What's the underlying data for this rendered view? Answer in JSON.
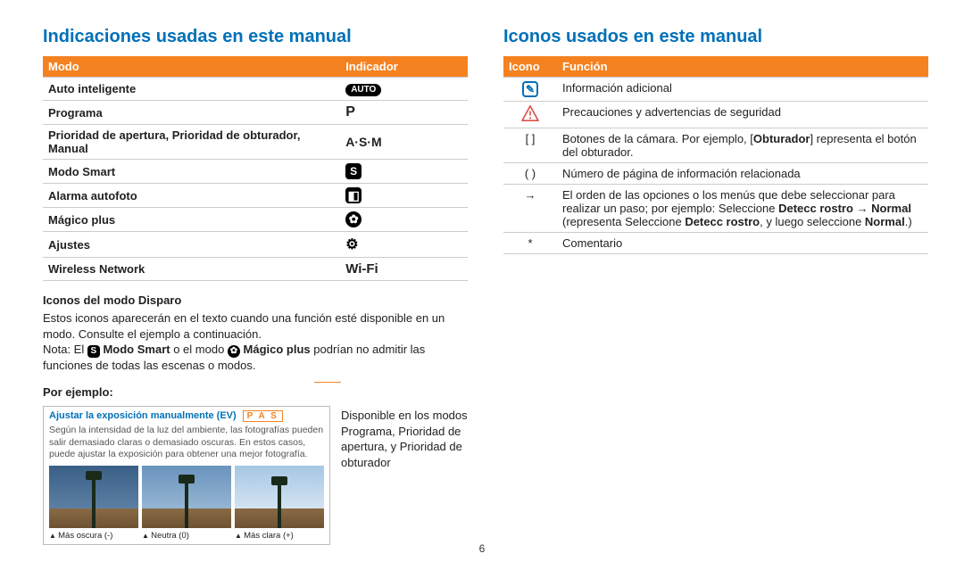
{
  "left": {
    "heading": "Indicaciones usadas en este manual",
    "table": {
      "head_mode": "Modo",
      "head_indicator": "Indicador",
      "rows": {
        "auto": "Auto inteligente",
        "auto_ind": "AUTO",
        "program": "Programa",
        "program_ind": "P",
        "asm": "Prioridad de apertura, Prioridad de obturador, Manual",
        "asm_ind": "A·S·M",
        "smart": "Modo Smart",
        "smart_ind": "S",
        "alarm": "Alarma autofoto",
        "magic": "Mágico plus",
        "settings": "Ajustes",
        "wireless": "Wireless Network",
        "wireless_ind": "Wi-Fi"
      }
    },
    "sub1_head": "Iconos del modo Disparo",
    "sub1_p1": "Estos iconos aparecerán en el texto cuando una función esté disponible en un modo. Consulte el ejemplo a continuación.",
    "sub1_p2a": "Nota: El ",
    "sub1_p2b": " Modo Smart",
    "sub1_p2c": " o el modo ",
    "sub1_p2d": " Mágico plus",
    "sub1_p2e": " podrían no admitir las funciones de todas las escenas o modos.",
    "example_head": "Por ejemplo:",
    "ex_title": "Ajustar la exposición manualmente (EV)",
    "ex_pas": "P A S",
    "ex_body": "Según la intensidad de la luz del ambiente, las fotografías pueden salir demasiado claras o demasiado oscuras. En estos casos, puede ajustar la exposición para obtener una mejor fotografía.",
    "cap_dark": "Más oscura (-)",
    "cap_neutral": "Neutra (0)",
    "cap_light": "Más clara (+)",
    "side_note": "Disponible en los modos Programa, Prioridad de apertura, y Prioridad de obturador"
  },
  "right": {
    "heading": "Iconos usados en este manual",
    "head_icon": "Icono",
    "head_func": "Función",
    "rows": {
      "info": "Información adicional",
      "warn": "Precauciones y advertencias de seguridad",
      "brackets_icon": "[  ]",
      "brackets_a": "Botones de la cámara. Por ejemplo, [",
      "brackets_bold": "Obturador",
      "brackets_b": "] representa el botón del obturador.",
      "paren_icon": "(  )",
      "paren": "Número de página de información relacionada",
      "arrow_icon": "→",
      "arrow_a": "El orden de las opciones o los menús que debe seleccionar para realizar un paso; por ejemplo: Seleccione ",
      "arrow_b1": "Detecc rostro",
      "arrow_mid": " → ",
      "arrow_b2": "Normal",
      "arrow_c": " (representa Seleccione ",
      "arrow_b3": "Detecc rostro",
      "arrow_d": ", y luego seleccione ",
      "arrow_b4": "Normal",
      "arrow_e": ".)",
      "star_icon": "*",
      "star": "Comentario"
    }
  },
  "page_number": "6"
}
